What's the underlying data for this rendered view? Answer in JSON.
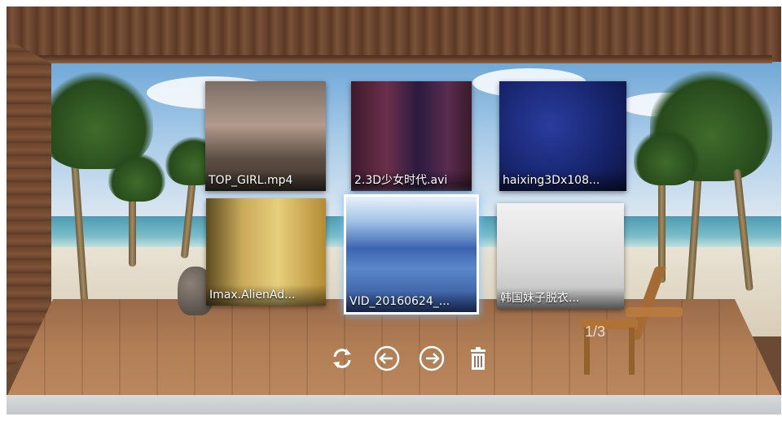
{
  "gallery": {
    "items": [
      {
        "title": "TOP_GIRL.mp4",
        "selected": false
      },
      {
        "title": "2.3D少女时代.avi",
        "selected": false
      },
      {
        "title": "haixing3Dx108...",
        "selected": false
      },
      {
        "title": "Imax.AlienAd...",
        "selected": false
      },
      {
        "title": "VID_20160624_...",
        "selected": true
      },
      {
        "title": "韩国妹子脱衣...",
        "selected": false
      }
    ]
  },
  "toolbar": {
    "buttons": [
      {
        "icon": "refresh-icon"
      },
      {
        "icon": "arrow-left-circle-icon"
      },
      {
        "icon": "arrow-right-circle-icon"
      },
      {
        "icon": "trash-icon"
      }
    ]
  },
  "pagination": {
    "label": "1/3"
  },
  "colors": {
    "selection_glow": "#78beff",
    "wood": "#b07d55",
    "sky": "#a5c9e8"
  }
}
